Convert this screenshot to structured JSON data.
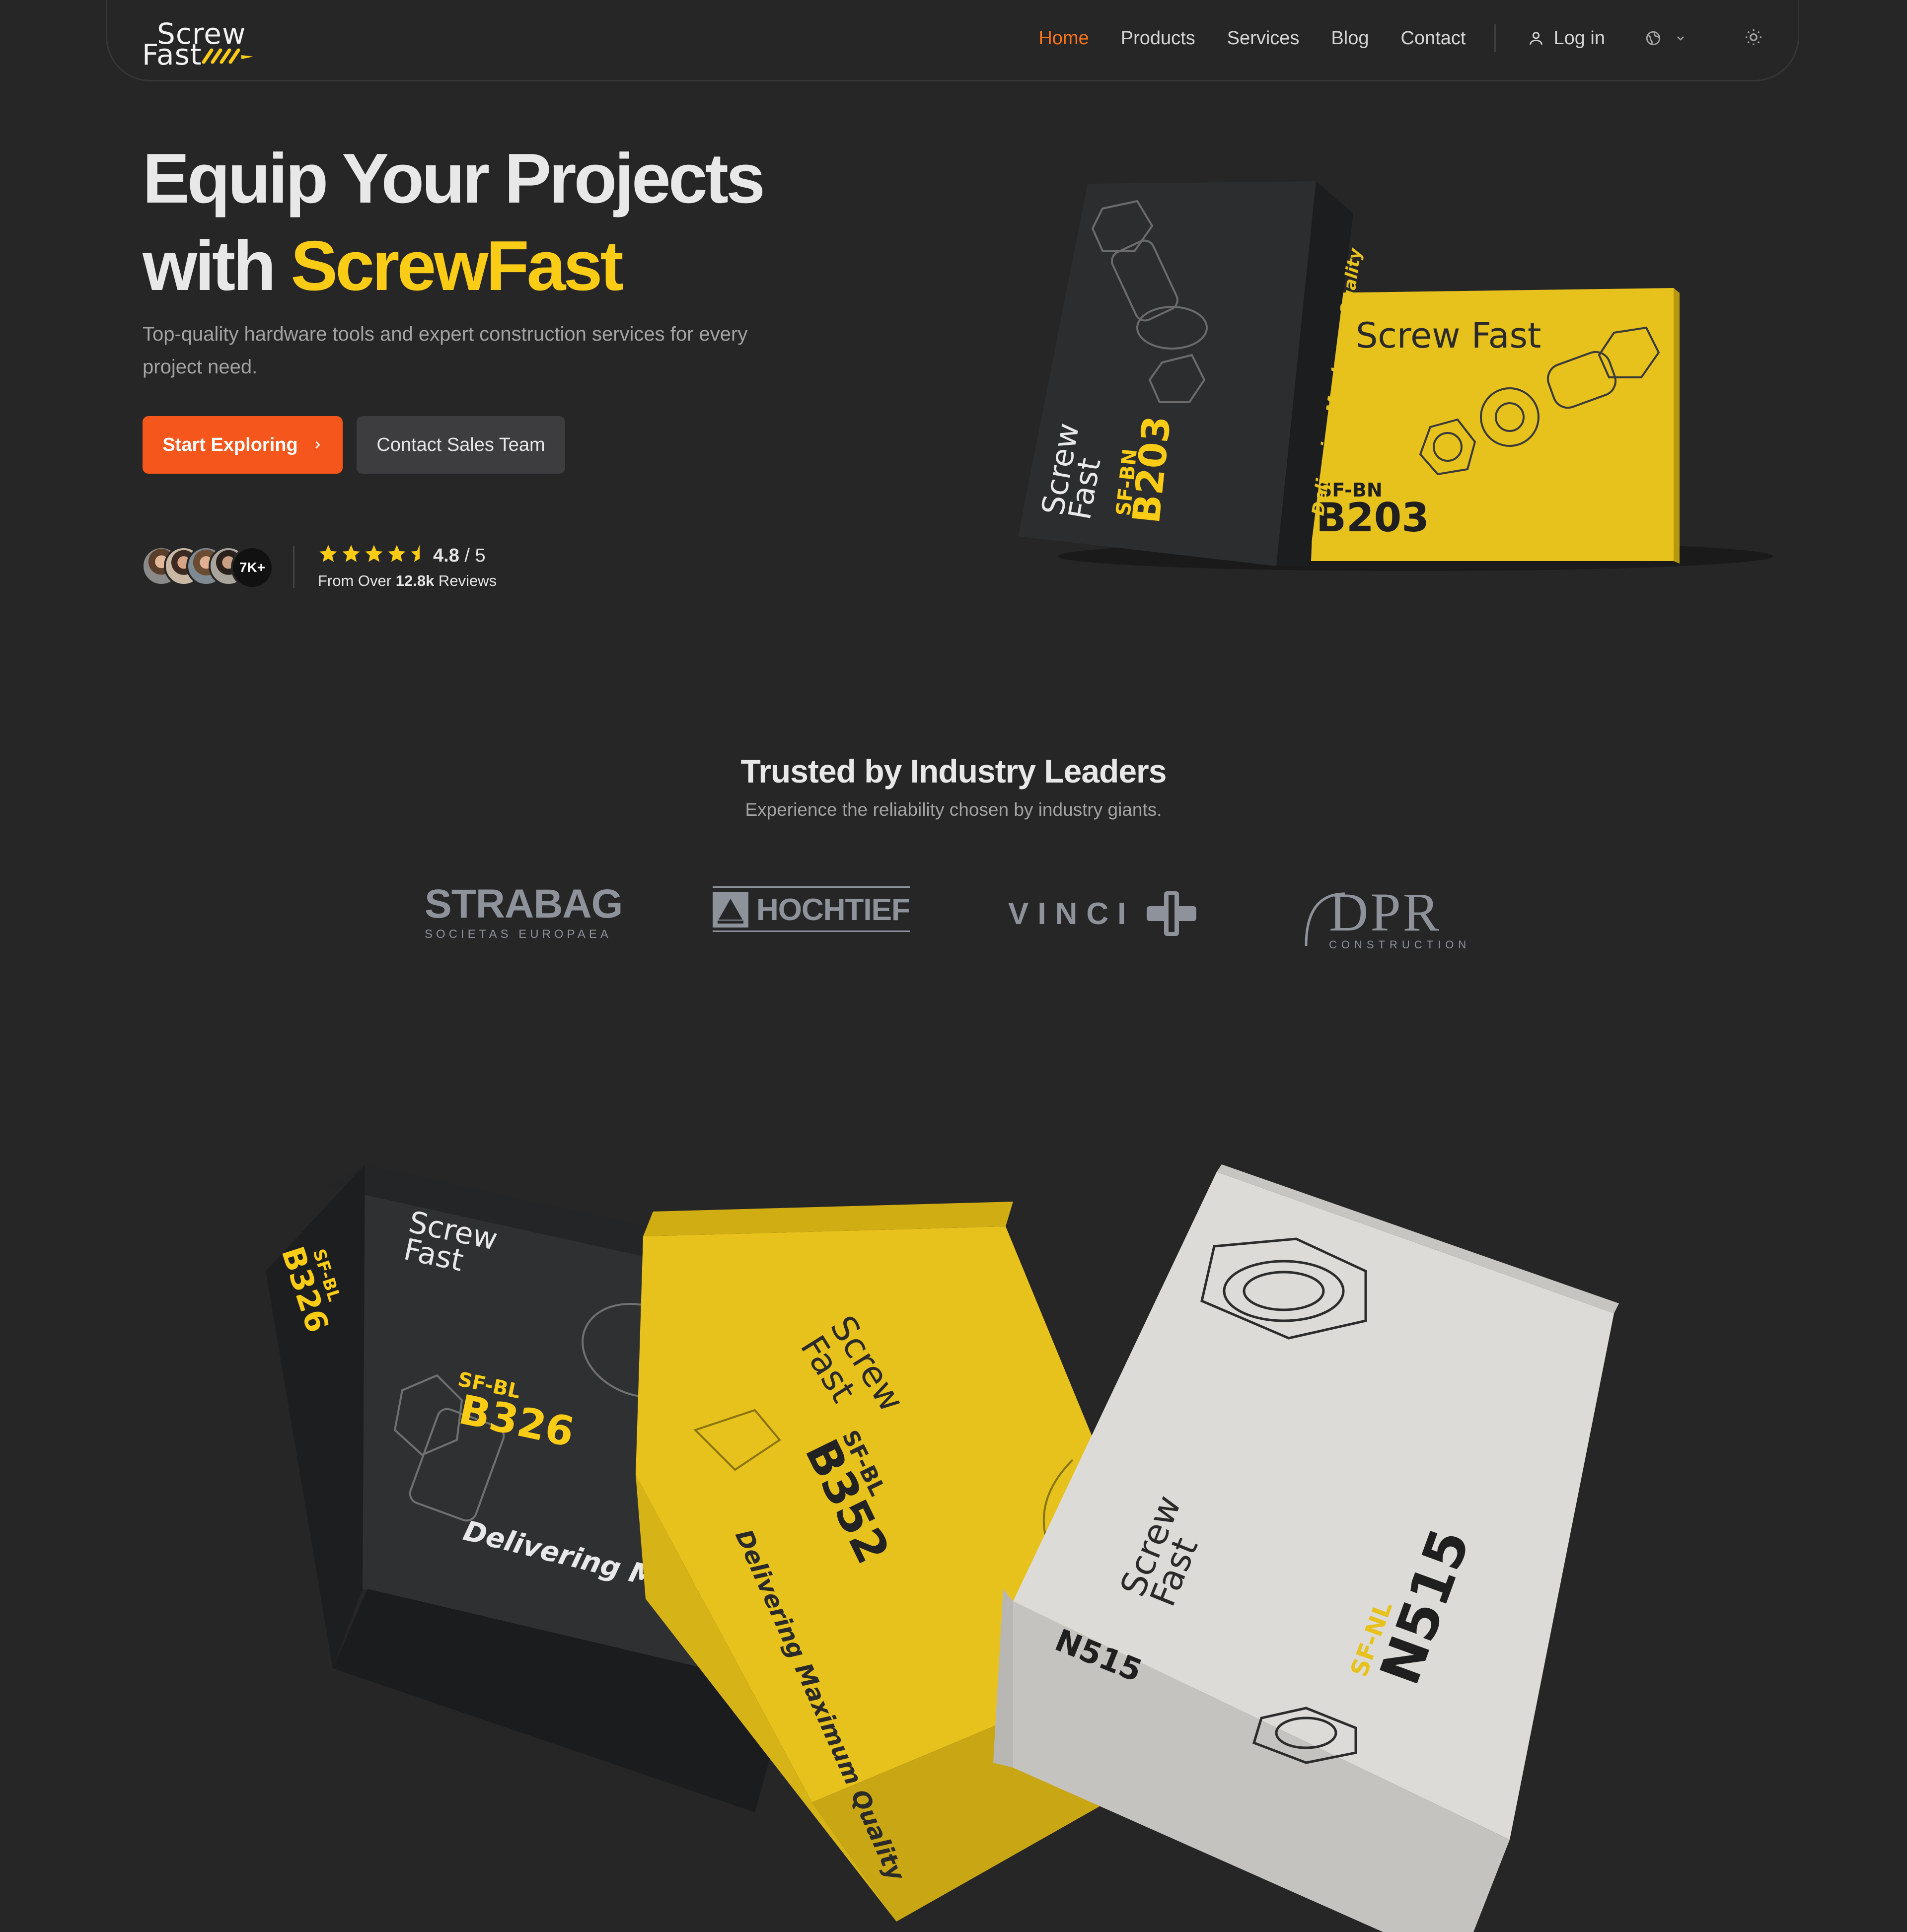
{
  "nav": {
    "logo_line1": "Screw",
    "logo_line2": "Fast",
    "links": [
      "Home",
      "Products",
      "Services",
      "Blog",
      "Contact"
    ],
    "active_index": 0,
    "login_label": "Log in",
    "lang_icon": "globe-icon",
    "theme_icon": "sun-icon"
  },
  "hero": {
    "title_line1": "Equip Your Projects",
    "title_prefix": "with ",
    "title_accent": "ScrewFast",
    "subtitle": "Top-quality hardware tools and expert construction services for every project need.",
    "primary_button": "Start Exploring",
    "secondary_button": "Contact Sales Team",
    "avatar_count": "7K+",
    "rating_value": "4.8",
    "rating_max": "/ 5",
    "stars": 4.5,
    "reviews_prefix": "From Over ",
    "reviews_count": "12.8k",
    "reviews_suffix": " Reviews"
  },
  "product_art": {
    "hero_boxes": {
      "box1_series": "SF-BN",
      "box1_code": "B203",
      "box1_tagline": "Delivering Maximum Quality",
      "box2_series": "SF-BN",
      "box2_code": "B203",
      "box2_brand": "Screw Fast"
    },
    "feature_boxes": {
      "dark_series": "SF-BL",
      "dark_code": "B326",
      "dark_tagline": "Delivering Maximum",
      "yellow_series": "SF-BL",
      "yellow_code": "B352",
      "yellow_tagline": "Delivering Maximum Quality",
      "white_series": "SF-NL",
      "white_code": "N515"
    }
  },
  "trusted": {
    "title": "Trusted by Industry Leaders",
    "subtitle": "Experience the reliability chosen by industry giants.",
    "partners": {
      "strabag": "STRABAG",
      "strabag_sub": "SOCIETAS EUROPAEA",
      "hochtief": "HOCHTIEF",
      "vinci": "VINCI",
      "dpr": "DPR",
      "dpr_sub": "CONSTRUCTION"
    }
  },
  "colors": {
    "background": "#262626",
    "accent_orange": "#f4561b",
    "accent_yellow": "#facc15",
    "box_yellow": "#e8c21c",
    "box_dark": "#2b2d2e",
    "box_white": "#dcdbd7"
  }
}
